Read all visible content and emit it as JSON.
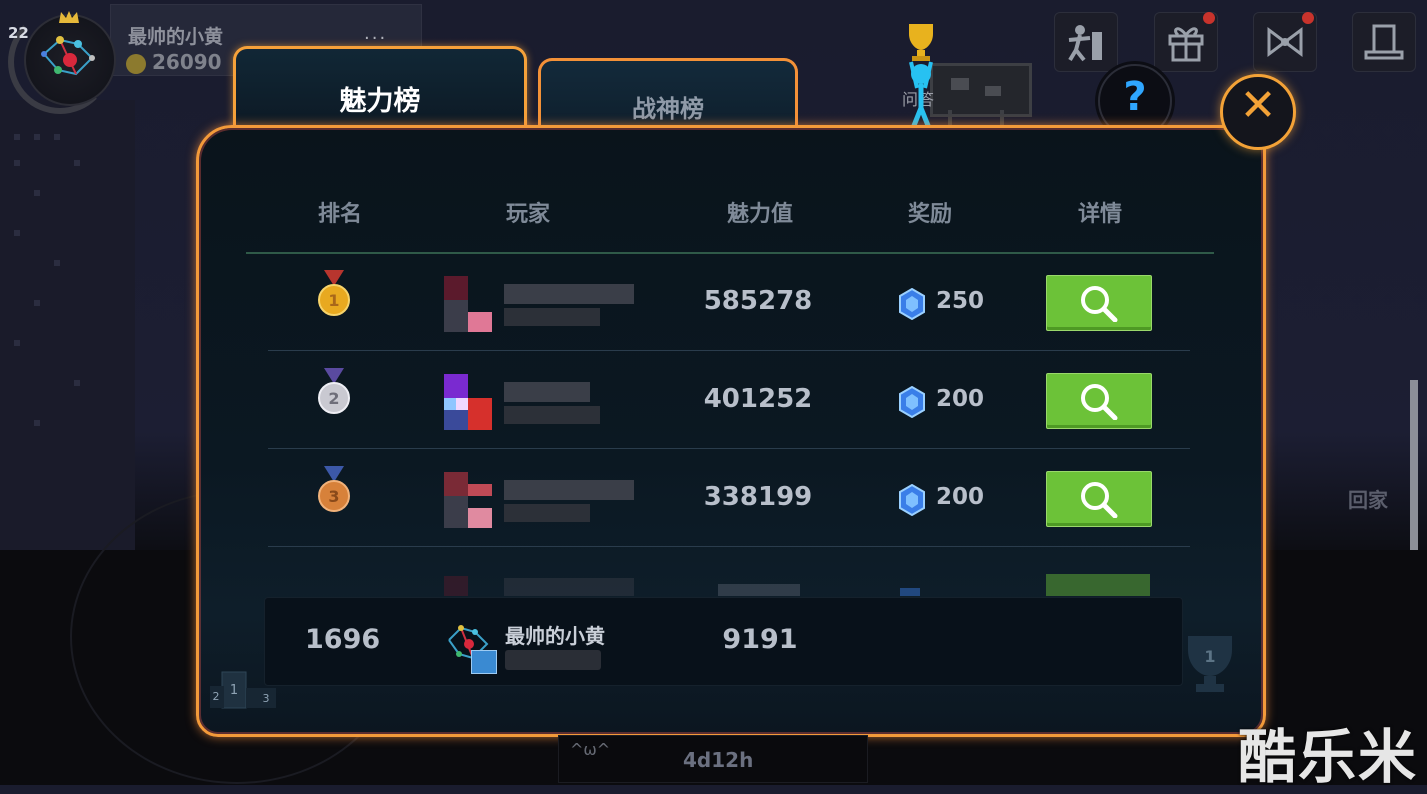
{
  "profile": {
    "level": "22",
    "name": "最帅的小黄",
    "coins": "26090",
    "more": "···"
  },
  "top_icons": [
    "stickman-icon",
    "gift-icon",
    "bow-icon",
    "tophat-icon"
  ],
  "tabs": {
    "active": "魅力榜",
    "inactive": "战神榜"
  },
  "background": {
    "home_label": "回家",
    "board_label": "问答"
  },
  "table": {
    "headers": {
      "rank": "排名",
      "player": "玩家",
      "charm": "魅力值",
      "reward": "奖励",
      "detail": "详情"
    },
    "rows": [
      {
        "rank": "1",
        "medal": "gold",
        "charm": "585278",
        "reward": "250"
      },
      {
        "rank": "2",
        "medal": "silver",
        "charm": "401252",
        "reward": "200"
      },
      {
        "rank": "3",
        "medal": "bronze",
        "charm": "338199",
        "reward": "200"
      }
    ]
  },
  "me": {
    "rank": "1696",
    "name": "最帅的小黄",
    "charm": "9191"
  },
  "podium": {
    "p1": "1",
    "p2": "2",
    "p3": "3",
    "trophy_num": "1"
  },
  "timer": {
    "face": "^ω^",
    "time": "4d12h"
  },
  "watermark": "酷乐米",
  "colors": {
    "accent_orange": "#f39a3a",
    "detail_green": "#6cc238",
    "help_blue": "#2fa6ff"
  }
}
